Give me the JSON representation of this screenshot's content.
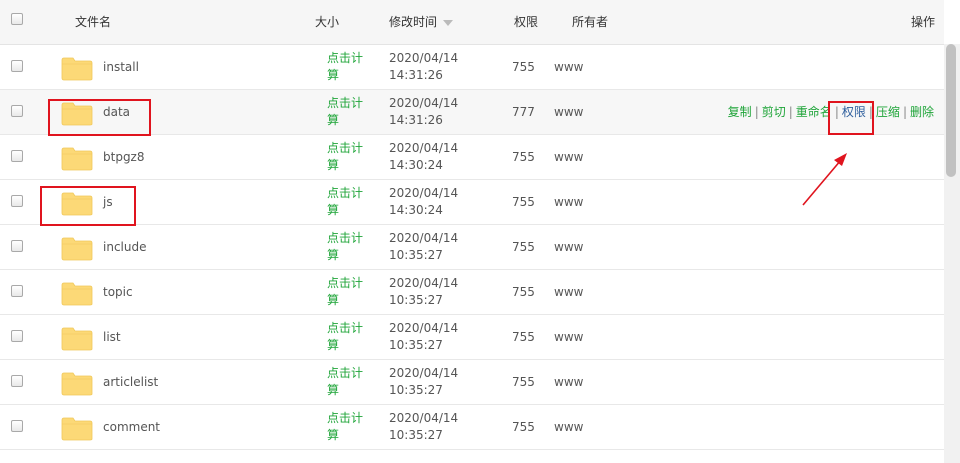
{
  "header": {
    "filename": "文件名",
    "size": "大小",
    "modified": "修改时间",
    "permission": "权限",
    "owner": "所有者",
    "actions": "操作"
  },
  "calc_label": "点击计算",
  "action_links": {
    "copy": "复制",
    "cut": "剪切",
    "rename": "重命名",
    "perm": "权限",
    "compress": "压缩",
    "delete": "删除",
    "separator": "|"
  },
  "rows": [
    {
      "name": "install",
      "date": "2020/04/14",
      "time": "14:31:26",
      "perm": "755",
      "owner": "www"
    },
    {
      "name": "data",
      "date": "2020/04/14",
      "time": "14:31:26",
      "perm": "777",
      "owner": "www"
    },
    {
      "name": "btpgz8",
      "date": "2020/04/14",
      "time": "14:30:24",
      "perm": "755",
      "owner": "www"
    },
    {
      "name": "js",
      "date": "2020/04/14",
      "time": "14:30:24",
      "perm": "755",
      "owner": "www"
    },
    {
      "name": "include",
      "date": "2020/04/14",
      "time": "10:35:27",
      "perm": "755",
      "owner": "www"
    },
    {
      "name": "topic",
      "date": "2020/04/14",
      "time": "10:35:27",
      "perm": "755",
      "owner": "www"
    },
    {
      "name": "list",
      "date": "2020/04/14",
      "time": "10:35:27",
      "perm": "755",
      "owner": "www"
    },
    {
      "name": "articlelist",
      "date": "2020/04/14",
      "time": "10:35:27",
      "perm": "755",
      "owner": "www"
    },
    {
      "name": "comment",
      "date": "2020/04/14",
      "time": "10:35:27",
      "perm": "755",
      "owner": "www"
    }
  ],
  "colors": {
    "accent": "#20a53a",
    "highlight": "#e0141e",
    "folder": "#fcd977"
  },
  "icons": {
    "folder": "folder-icon",
    "sort": "sort-desc-icon"
  }
}
